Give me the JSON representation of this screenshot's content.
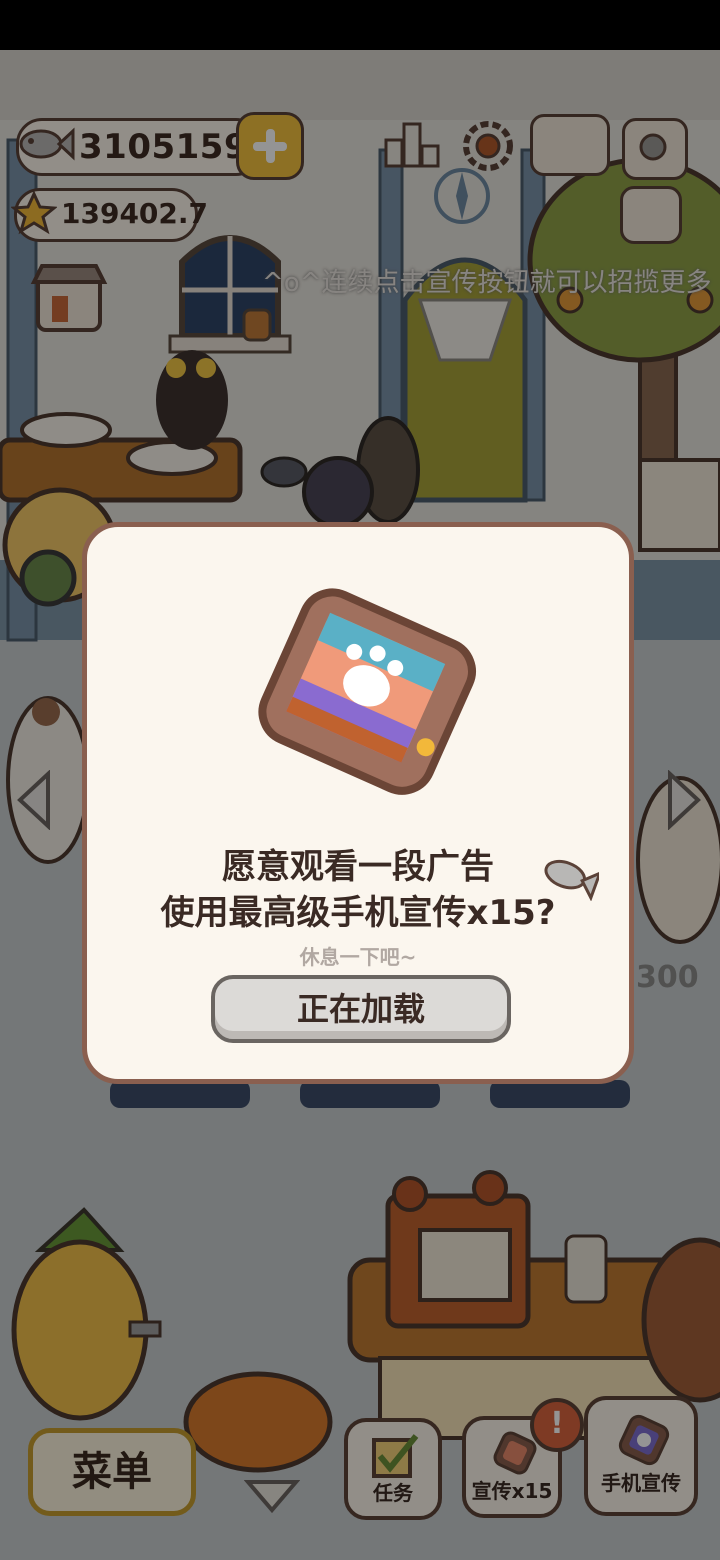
{
  "hud": {
    "fish_count": "3105159",
    "star_count": "139402.7"
  },
  "scroll_message": "^o^连续点击宣传按钮就可以招揽更多",
  "dialog": {
    "line1": "愿意观看一段广告",
    "line2": "使用最高级手机宣传x15?",
    "subtext": "休息一下吧~",
    "button_label": "正在加载"
  },
  "background_price": "300",
  "bottom": {
    "menu_label": "菜单",
    "tasks_label": "任务",
    "promo_label": "宣传x15",
    "promo_badge": "!",
    "phone_promo_label": "手机宣传"
  },
  "colors": {
    "dim_overlay": "rgba(0,0,0,0.42)",
    "dialog_bg": "#fbf6ee",
    "dialog_border": "#8a5f4f",
    "menu_border": "#c79d2f",
    "badge": "#d9643f"
  },
  "icons": [
    "fish-icon",
    "star-icon",
    "plus-icon",
    "leaderboard-icon",
    "settings-gear-icon",
    "cat-book-icon",
    "camera-icon",
    "newspaper-icon",
    "shop-icon",
    "phone-card-icon",
    "checkbox-icon",
    "chevron-down-icon"
  ]
}
